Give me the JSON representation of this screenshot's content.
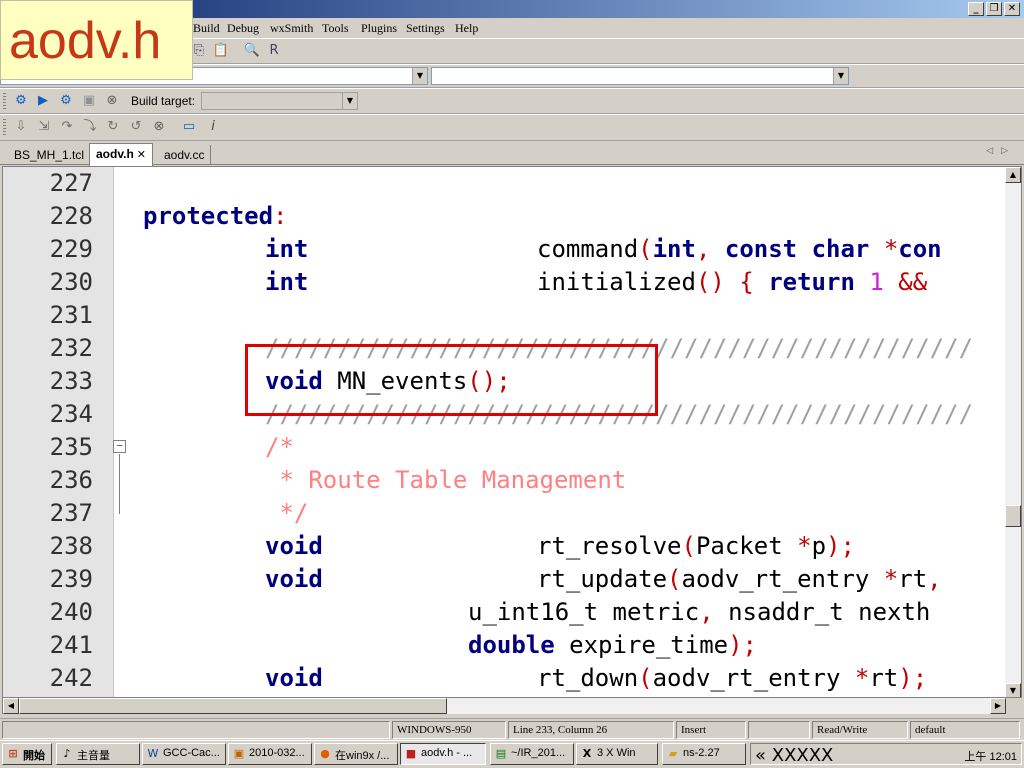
{
  "overlay_label": "aodv.h",
  "window_controls": {
    "minimize": "_",
    "restore": "❐",
    "close": "✕"
  },
  "menu": [
    "Build",
    "Debug",
    "wxSmith",
    "Tools",
    "Plugins",
    "Settings",
    "Help"
  ],
  "toolbar3": {
    "build_target_label": "Build target:"
  },
  "tabs": [
    {
      "label": "BS_MH_1.tcl"
    },
    {
      "label": "aodv.h",
      "close": "✕"
    },
    {
      "label": "aodv.cc"
    }
  ],
  "editor": {
    "line_numbers": [
      "227",
      "228",
      "229",
      "230",
      "231",
      "232",
      "233",
      "234",
      "235",
      "236",
      "237",
      "238",
      "239",
      "240",
      "241",
      "242"
    ],
    "code": {
      "l228_kw": "protected",
      "l228_colon": ":",
      "l229_kw1": "int",
      "l229_fn": "command",
      "l229_rest_kw": "int",
      "l229_kw3": "const char",
      "l229_star": "*",
      "l229_tail": "con",
      "l230_kw": "int",
      "l230_fn": "initialized",
      "l230_paren": "() {",
      "l230_ret": "return",
      "l230_num": "1",
      "l230_amp": "&&",
      "l232_slashes": "/////////////////////////////////////////////////",
      "l233_kw": "void",
      "l233_fn": "MN_events",
      "l233_tail": "();",
      "l234_slashes": "/////////////////////////////////////////////////",
      "l235": "/*",
      "l236": " * Route Table Management",
      "l237": " */",
      "l238_kw": "void",
      "l238_fn": "rt_resolve",
      "l238_p1": "(",
      "l238_arg": "Packet ",
      "l238_p2": "*",
      "l238_arg2": "p",
      "l238_p3": ");",
      "l239_kw": "void",
      "l239_fn": "rt_update",
      "l239_p1": "(",
      "l239_arg": "aodv_rt_entry ",
      "l239_p2": "*",
      "l239_arg2": "rt",
      "l239_p3": ",",
      "l240_a": "u_int16_t metric",
      "l240_c": ",",
      "l240_b": " nsaddr_t nexth",
      "l241_kw": "double",
      "l241_a": " expire_time",
      "l241_p": ");",
      "l242_kw": "void",
      "l242_fn": "rt_down",
      "l242_p1": "(",
      "l242_arg": "aodv_rt_entry ",
      "l242_p2": "*",
      "l242_arg2": "rt",
      "l242_p3": ");"
    }
  },
  "status": {
    "encoding": "WINDOWS-950",
    "position": "Line 233, Column 26",
    "mode": "Insert",
    "access": "Read/Write",
    "profile": "default"
  },
  "taskbar": {
    "start": "開始",
    "tasks": [
      "主音量",
      "GCC-Cac...",
      "2010-032...",
      "在win9x /...",
      "aodv.h - ...",
      "~/IR_201...",
      "3 X Win",
      "ns-2.27"
    ],
    "tray_text": "« XXXXX",
    "clock": "上午 12:01"
  }
}
